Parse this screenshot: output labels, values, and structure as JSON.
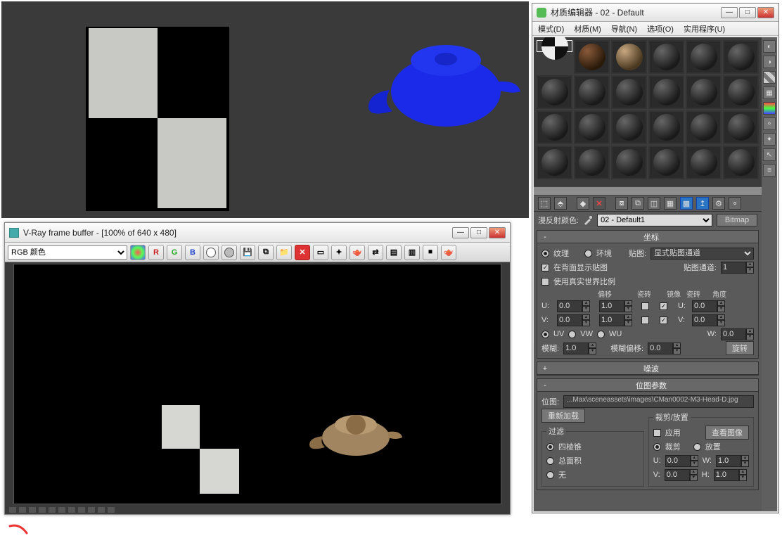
{
  "viewport": {},
  "vfb": {
    "title": "V-Ray frame buffer - [100% of 640 x 480]",
    "channel": "RGB 颜色",
    "buttons": {
      "r": "R",
      "g": "G",
      "b": "B"
    }
  },
  "mat": {
    "title": "材质编辑器 - 02 - Default",
    "menu": {
      "mode": "模式(D)",
      "material": "材质(M)",
      "nav": "导航(N)",
      "options": "选项(O)",
      "util": "实用程序(U)"
    },
    "nameRow": {
      "label": "漫反射颜色:",
      "selected": "02 - Default1",
      "type": "Bitmap"
    },
    "coord": {
      "title": "坐标",
      "texture": "纹理",
      "env": "环境",
      "mapLbl": "贴图:",
      "mapSel": "显式贴图通道",
      "show": "在背面显示贴图",
      "realworld": "使用真实世界比例",
      "chanLbl": "贴图通道:",
      "chan": "1",
      "hdr": {
        "offset": "偏移",
        "tile": "瓷砖",
        "mirror": "镜像",
        "tile2": "瓷砖",
        "angle": "角度"
      },
      "u": "U:",
      "v": "V:",
      "w": "W:",
      "uOff": "0.0",
      "uTile": "1.0",
      "uAng": "0.0",
      "vOff": "0.0",
      "vTile": "1.0",
      "vAng": "0.0",
      "wAng": "0.0",
      "uv": "UV",
      "vw": "VW",
      "wu": "WU",
      "blurLbl": "模糊:",
      "blur": "1.0",
      "blurOffLbl": "模糊偏移:",
      "blurOff": "0.0",
      "rotate": "旋转"
    },
    "noise": {
      "title": "噪波"
    },
    "bitmap": {
      "title": "位图参数",
      "pathLbl": "位图:",
      "path": "...Max\\sceneassets\\images\\CMan0002-M3-Head-D.jpg",
      "reload": "重新加载",
      "filter": {
        "title": "过滤",
        "pyr": "四棱锥",
        "sum": "总面积",
        "none": "无"
      },
      "crop": {
        "title": "裁剪/放置",
        "apply": "应用",
        "view": "查看图像",
        "crop": "裁剪",
        "place": "放置",
        "u": "U:",
        "v": "V:",
        "w": "W:",
        "h": "H:",
        "uval": "0.0",
        "vval": "0.0",
        "wval": "1.0",
        "hval": "1.0"
      }
    }
  }
}
